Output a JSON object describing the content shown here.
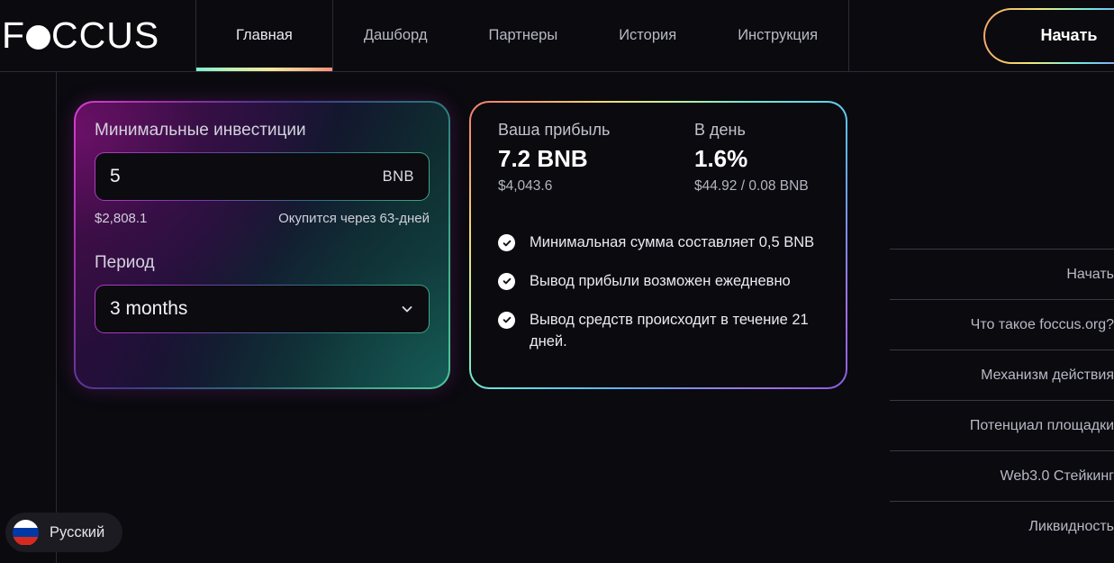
{
  "header": {
    "logo": {
      "prefix": "F",
      "dot": "o",
      "suffix": "CCUS"
    },
    "nav": [
      {
        "label": "Главная",
        "active": true
      },
      {
        "label": "Дашборд",
        "active": false
      },
      {
        "label": "Партнеры",
        "active": false
      },
      {
        "label": "История",
        "active": false
      },
      {
        "label": "Инструкция",
        "active": false
      }
    ],
    "cta_label": "Начать"
  },
  "calculator": {
    "amount_label": "Минимальные инвестиции",
    "amount_value": "5",
    "amount_unit": "BNB",
    "amount_usd": "$2,808.1",
    "payback_text": "Окупится через 63-дней",
    "period_label": "Период",
    "period_value": "3 months",
    "period_icon": "chevron-down-icon"
  },
  "profit": {
    "stats": [
      {
        "label": "Ваша прибыль",
        "value": "7.2 BNB",
        "sub": "$4,043.6"
      },
      {
        "label": "В день",
        "value": "1.6%",
        "sub": "$44.92 / 0.08 BNB"
      }
    ],
    "bullets": [
      {
        "icon": "check-circle-icon",
        "text": "Минимальная сумма составляет 0,5 BNB"
      },
      {
        "icon": "check-circle-icon",
        "text": "Вывод прибыли возможен ежедневно"
      },
      {
        "icon": "check-circle-icon",
        "text": "Вывод средств происходит в течение 21 дней."
      }
    ]
  },
  "toc": {
    "items": [
      {
        "label": "Начать"
      },
      {
        "label": "Что такое foccus.org?"
      },
      {
        "label": "Механизм действия"
      },
      {
        "label": "Потенциал площадки"
      },
      {
        "label": "Web3.0 Стейкинг"
      },
      {
        "label": "Ликвидность"
      }
    ]
  },
  "language": {
    "icon": "russia-flag-icon",
    "label": "Русский"
  },
  "colors": {
    "background": "#0a0a0f",
    "accent_mint": "#7fefd5",
    "accent_yellow": "#f5e79e",
    "accent_salmon": "#f78f7a",
    "accent_magenta": "#d83fd0",
    "accent_teal": "#4fc79a",
    "divider": "#2b2b33"
  }
}
